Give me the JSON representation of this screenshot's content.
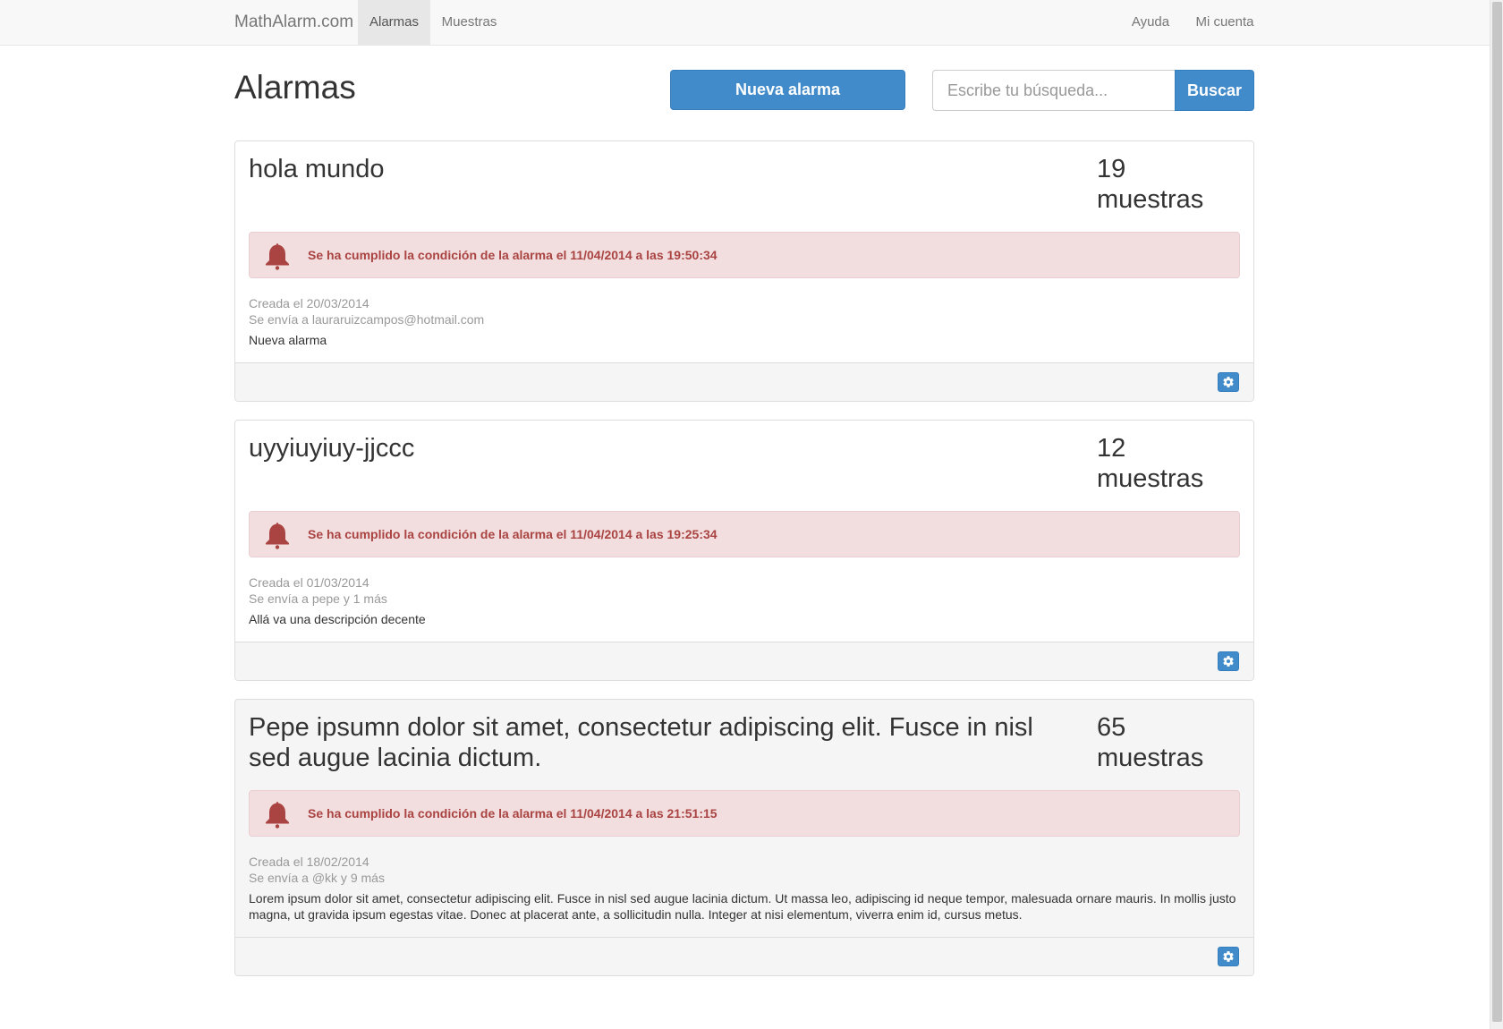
{
  "navbar": {
    "brand": "MathAlarm.com",
    "links": [
      {
        "label": "Alarmas",
        "active": true
      },
      {
        "label": "Muestras",
        "active": false
      }
    ],
    "right_links": [
      {
        "label": "Ayuda"
      },
      {
        "label": "Mi cuenta"
      }
    ]
  },
  "page": {
    "title": "Alarmas",
    "new_button": "Nueva alarma",
    "search_placeholder": "Escribe tu búsqueda...",
    "search_button": "Buscar"
  },
  "colors": {
    "primary": "#428bca",
    "alert_bg": "#f2dede",
    "alert_text": "#a94442",
    "muted": "#999999"
  },
  "alarms": [
    {
      "title": "hola mundo",
      "samples_count": "19",
      "samples_label": "muestras",
      "alert_icon": "bell-icon",
      "alert": "Se ha cumplido la condición de la alarma el 11/04/2014 a las 19:50:34",
      "created": "Creada el 20/03/2014",
      "sent_to": "Se envía a lauraruizcampos@hotmail.com",
      "description": "Nueva alarma",
      "settings_icon": "gear-icon"
    },
    {
      "title": "uyyiuyiuy-jjccc",
      "samples_count": "12",
      "samples_label": "muestras",
      "alert_icon": "bell-icon",
      "alert": "Se ha cumplido la condición de la alarma el 11/04/2014 a las 19:25:34",
      "created": "Creada el 01/03/2014",
      "sent_to": "Se envía a pepe y 1 más",
      "description": "Allá va una descripción decente",
      "settings_icon": "gear-icon"
    },
    {
      "title": "Pepe ipsumn dolor sit amet, consectetur adipiscing elit. Fusce in nisl sed augue lacinia dictum.",
      "samples_count": "65",
      "samples_label": "muestras",
      "alert_icon": "bell-icon",
      "alert": "Se ha cumplido la condición de la alarma el 11/04/2014 a las 21:51:15",
      "created": "Creada el 18/02/2014",
      "sent_to": "Se envía a @kk y 9 más",
      "description": "Lorem ipsum dolor sit amet, consectetur adipiscing elit. Fusce in nisl sed augue lacinia dictum. Ut massa leo, adipiscing id neque tempor, malesuada ornare mauris. In mollis justo magna, ut gravida ipsum egestas vitae. Donec at placerat ante, a sollicitudin nulla. Integer at nisi elementum, viverra enim id, cursus metus.",
      "settings_icon": "gear-icon"
    }
  ]
}
